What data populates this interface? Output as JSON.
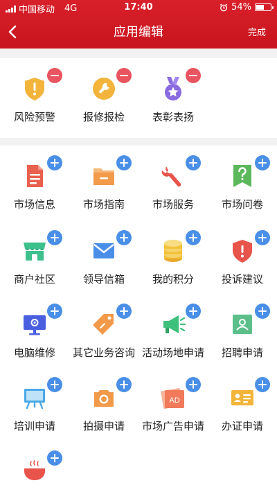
{
  "status_bar": {
    "carrier": "中国移动",
    "network": "4G",
    "time": "17:40",
    "battery": "54%",
    "battery_level": 0.54
  },
  "header": {
    "title": "应用编辑",
    "done_label": "完成"
  },
  "added_apps": [
    {
      "label": "风险预警",
      "icon": "warning-shield-icon",
      "color": "#f3b43c"
    },
    {
      "label": "报修报检",
      "icon": "wrench-icon",
      "color": "#f3b43c"
    },
    {
      "label": "表彰表扬",
      "icon": "medal-icon",
      "color": "#8a6be0"
    }
  ],
  "available_apps": [
    {
      "label": "市场信息",
      "icon": "document-icon",
      "color": "#e8614e"
    },
    {
      "label": "市场指南",
      "icon": "folder-icon",
      "color": "#f29a4a"
    },
    {
      "label": "市场服务",
      "icon": "wrench-icon",
      "color": "#e8544c"
    },
    {
      "label": "市场问卷",
      "icon": "question-flag-icon",
      "color": "#5cb85c"
    },
    {
      "label": "商户社区",
      "icon": "shop-icon",
      "color": "#3cc08c"
    },
    {
      "label": "领导信箱",
      "icon": "mail-icon",
      "color": "#4a8fe7"
    },
    {
      "label": "我的积分",
      "icon": "coins-icon",
      "color": "#f2c23a"
    },
    {
      "label": "投诉建议",
      "icon": "alert-shield-icon",
      "color": "#e8544c"
    },
    {
      "label": "电脑维修",
      "icon": "computer-icon",
      "color": "#4a5fe0"
    },
    {
      "label": "其它业务咨询",
      "icon": "tag-icon",
      "color": "#f29a4a"
    },
    {
      "label": "活动场地申请",
      "icon": "megaphone-icon",
      "color": "#3cc07a"
    },
    {
      "label": "招聘申请",
      "icon": "resume-icon",
      "color": "#5cbf8a"
    },
    {
      "label": "培训申请",
      "icon": "training-board-icon",
      "color": "#4aa8e7"
    },
    {
      "label": "拍摄申请",
      "icon": "camera-icon",
      "color": "#f29a4a"
    },
    {
      "label": "市场广告申请",
      "icon": "ad-icon",
      "color": "#f07a5a"
    },
    {
      "label": "办证申请",
      "icon": "id-card-icon",
      "color": "#f2b43a"
    },
    {
      "label": "",
      "icon": "bowl-icon",
      "color": "#e8544c"
    }
  ]
}
